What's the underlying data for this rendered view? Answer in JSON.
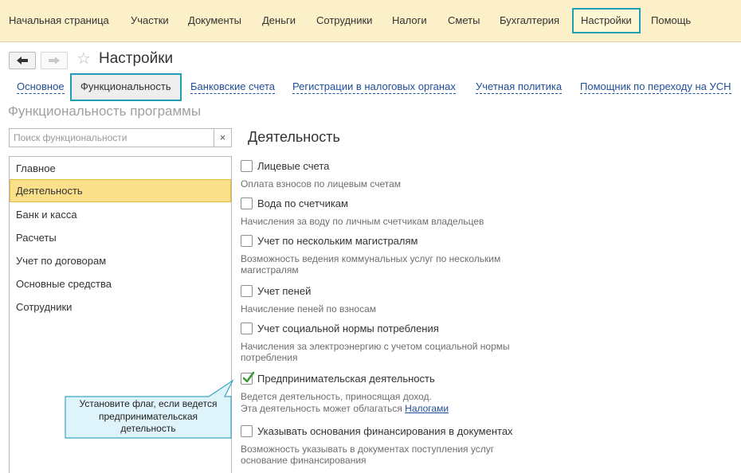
{
  "menu": {
    "items": [
      {
        "label": "Начальная страница"
      },
      {
        "label": "Участки"
      },
      {
        "label": "Документы"
      },
      {
        "label": "Деньги"
      },
      {
        "label": "Сотрудники"
      },
      {
        "label": "Налоги"
      },
      {
        "label": "Сметы"
      },
      {
        "label": "Бухгалтерия"
      },
      {
        "label": "Настройки",
        "active": true
      },
      {
        "label": "Помощь"
      }
    ]
  },
  "toolbar": {
    "back_icon": "arrow-left-icon",
    "forward_icon": "arrow-right-icon",
    "favorite_icon": "star-icon",
    "title": "Настройки"
  },
  "tabs": [
    {
      "label": "Основное"
    },
    {
      "label": "Функциональность",
      "active": true
    },
    {
      "label": "Банковские счета"
    },
    {
      "label": "Регистрации в налоговых органах"
    },
    {
      "label": "Учетная политика"
    },
    {
      "label": "Помощник по переходу на УСН"
    }
  ],
  "section_title": "Функциональность программы",
  "search": {
    "placeholder": "Поиск функциональности",
    "value": "",
    "clear_label": "×"
  },
  "sidebar": {
    "items": [
      {
        "label": "Главное"
      },
      {
        "label": "Деятельность",
        "selected": true
      },
      {
        "label": "Банк и касса"
      },
      {
        "label": "Расчеты"
      },
      {
        "label": "Учет по договорам"
      },
      {
        "label": "Основные средства"
      },
      {
        "label": "Сотрудники"
      }
    ]
  },
  "panel": {
    "heading": "Деятельность",
    "options": [
      {
        "label": "Лицевые счета",
        "checked": false,
        "desc": [
          "Оплата взносов по лицевым счетам"
        ]
      },
      {
        "label": "Вода по счетчикам",
        "checked": false,
        "desc": [
          "Начисления за воду по личным счетчикам владельцев"
        ]
      },
      {
        "label": "Учет по нескольким магистралям",
        "checked": false,
        "desc": [
          "Возможность ведения коммунальных услуг по нескольким",
          "магистралям"
        ]
      },
      {
        "label": "Учет пеней",
        "checked": false,
        "desc": [
          "Начисление пеней по взносам"
        ]
      },
      {
        "label": "Учет социальной нормы потребления",
        "checked": false,
        "desc": [
          "Начисления за электроэнергию с учетом социальной нормы",
          "потребления"
        ]
      },
      {
        "label": "Предпринимательская деятельность",
        "checked": true,
        "desc": [
          "Ведется деятельность, приносящая доход.",
          "Эта деятельность может облагаться "
        ],
        "desc_link": "Налогами"
      },
      {
        "label": "Указывать основания финансирования в документах",
        "checked": false,
        "desc": [
          "Возможность указывать в документах поступления услуг",
          "основание финансирования"
        ]
      }
    ]
  },
  "callout": {
    "lines": [
      "Установите флаг, если ведется",
      "предпринимательская",
      "детельность"
    ]
  },
  "colors": {
    "accent_frame": "#1e9fb5",
    "menu_bg": "#fbf0c8",
    "selected_row": "#fbe08c",
    "check_green": "#3a9a3a",
    "link": "#1f4e9a",
    "callout_fill": "#dff3fb"
  }
}
